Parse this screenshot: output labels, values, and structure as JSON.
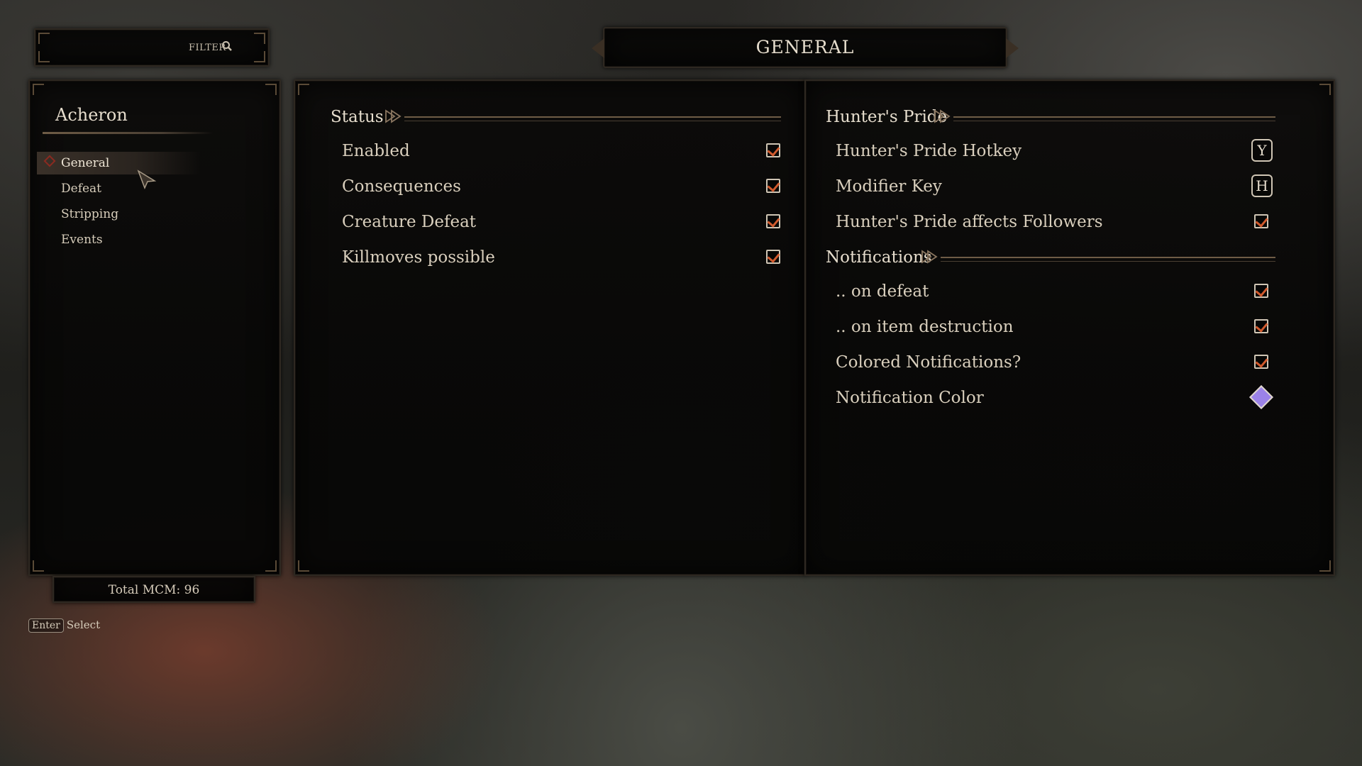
{
  "filter": {
    "label": "FILTER",
    "icon": "search-icon"
  },
  "page_title": "GENERAL",
  "sidebar": {
    "mod_name": "Acheron",
    "items": [
      {
        "label": "General",
        "active": true
      },
      {
        "label": "Defeat"
      },
      {
        "label": "Stripping"
      },
      {
        "label": "Events"
      }
    ]
  },
  "total_mcm": "Total MCM: 96",
  "hint": {
    "key": "Enter",
    "action": "Select"
  },
  "left_column": {
    "section_title": "Status",
    "options": [
      {
        "label": "Enabled",
        "checked": true
      },
      {
        "label": "Consequences",
        "checked": true
      },
      {
        "label": "Creature Defeat",
        "checked": true
      },
      {
        "label": "Killmoves possible",
        "checked": true
      }
    ]
  },
  "right_column": {
    "hunters_pride": {
      "section_title": "Hunter's Pride",
      "options": [
        {
          "label": "Hunter's Pride Hotkey",
          "key": "Y"
        },
        {
          "label": "Modifier Key",
          "key": "H"
        },
        {
          "label": "Hunter's Pride affects Followers",
          "checked": true
        }
      ]
    },
    "notifications": {
      "section_title": "Notifications",
      "options": [
        {
          "label": ".. on defeat",
          "checked": true
        },
        {
          "label": ".. on item destruction",
          "checked": true
        },
        {
          "label": "Colored Notifications?",
          "checked": true
        },
        {
          "label": "Notification Color",
          "color": "#9b82e8"
        }
      ]
    }
  },
  "colors": {
    "accent_check": "#d15a2d",
    "active_marker": "#8a2a20"
  }
}
